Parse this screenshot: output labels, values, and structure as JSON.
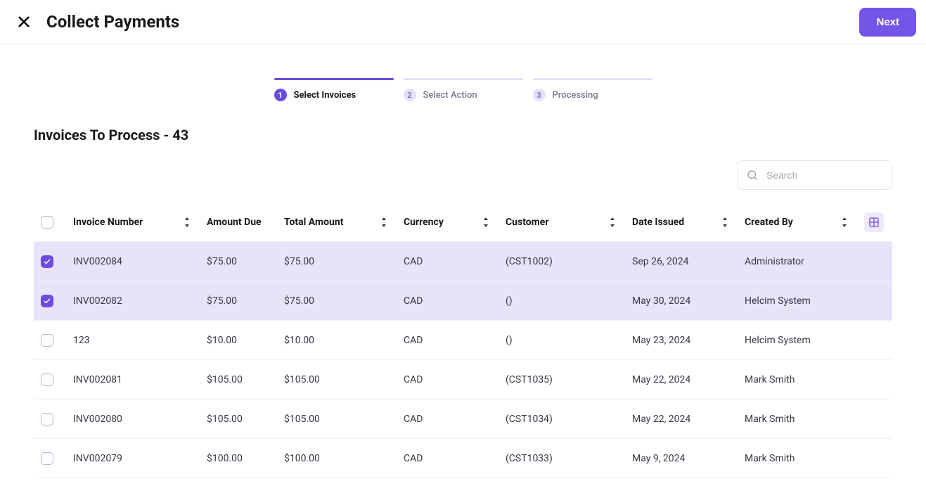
{
  "header": {
    "title": "Collect Payments",
    "next_label": "Next"
  },
  "stepper": [
    {
      "num": "1",
      "label": "Select Invoices",
      "active": true
    },
    {
      "num": "2",
      "label": "Select Action",
      "active": false
    },
    {
      "num": "3",
      "label": "Processing",
      "active": false
    }
  ],
  "section_title": "Invoices To Process - 43",
  "search": {
    "placeholder": "Search"
  },
  "columns": {
    "invoice_number": "Invoice Number",
    "amount_due": "Amount Due",
    "total_amount": "Total Amount",
    "currency": "Currency",
    "customer": "Customer",
    "date_issued": "Date Issued",
    "created_by": "Created By"
  },
  "rows": [
    {
      "selected": true,
      "invoice_number": "INV002084",
      "amount_due": "$75.00",
      "total_amount": "$75.00",
      "currency": "CAD",
      "customer": "(CST1002)",
      "date_issued": "Sep 26, 2024",
      "created_by": "Administrator"
    },
    {
      "selected": true,
      "invoice_number": "INV002082",
      "amount_due": "$75.00",
      "total_amount": "$75.00",
      "currency": "CAD",
      "customer": "()",
      "date_issued": "May 30, 2024",
      "created_by": "Helcim System"
    },
    {
      "selected": false,
      "invoice_number": "123",
      "amount_due": "$10.00",
      "total_amount": "$10.00",
      "currency": "CAD",
      "customer": "()",
      "date_issued": "May 23, 2024",
      "created_by": "Helcim System"
    },
    {
      "selected": false,
      "invoice_number": "INV002081",
      "amount_due": "$105.00",
      "total_amount": "$105.00",
      "currency": "CAD",
      "customer": "(CST1035)",
      "date_issued": "May 22, 2024",
      "created_by": "Mark Smith"
    },
    {
      "selected": false,
      "invoice_number": "INV002080",
      "amount_due": "$105.00",
      "total_amount": "$105.00",
      "currency": "CAD",
      "customer": "(CST1034)",
      "date_issued": "May 22, 2024",
      "created_by": "Mark Smith"
    },
    {
      "selected": false,
      "invoice_number": "INV002079",
      "amount_due": "$100.00",
      "total_amount": "$100.00",
      "currency": "CAD",
      "customer": "(CST1033)",
      "date_issued": "May 9, 2024",
      "created_by": "Mark Smith"
    }
  ]
}
